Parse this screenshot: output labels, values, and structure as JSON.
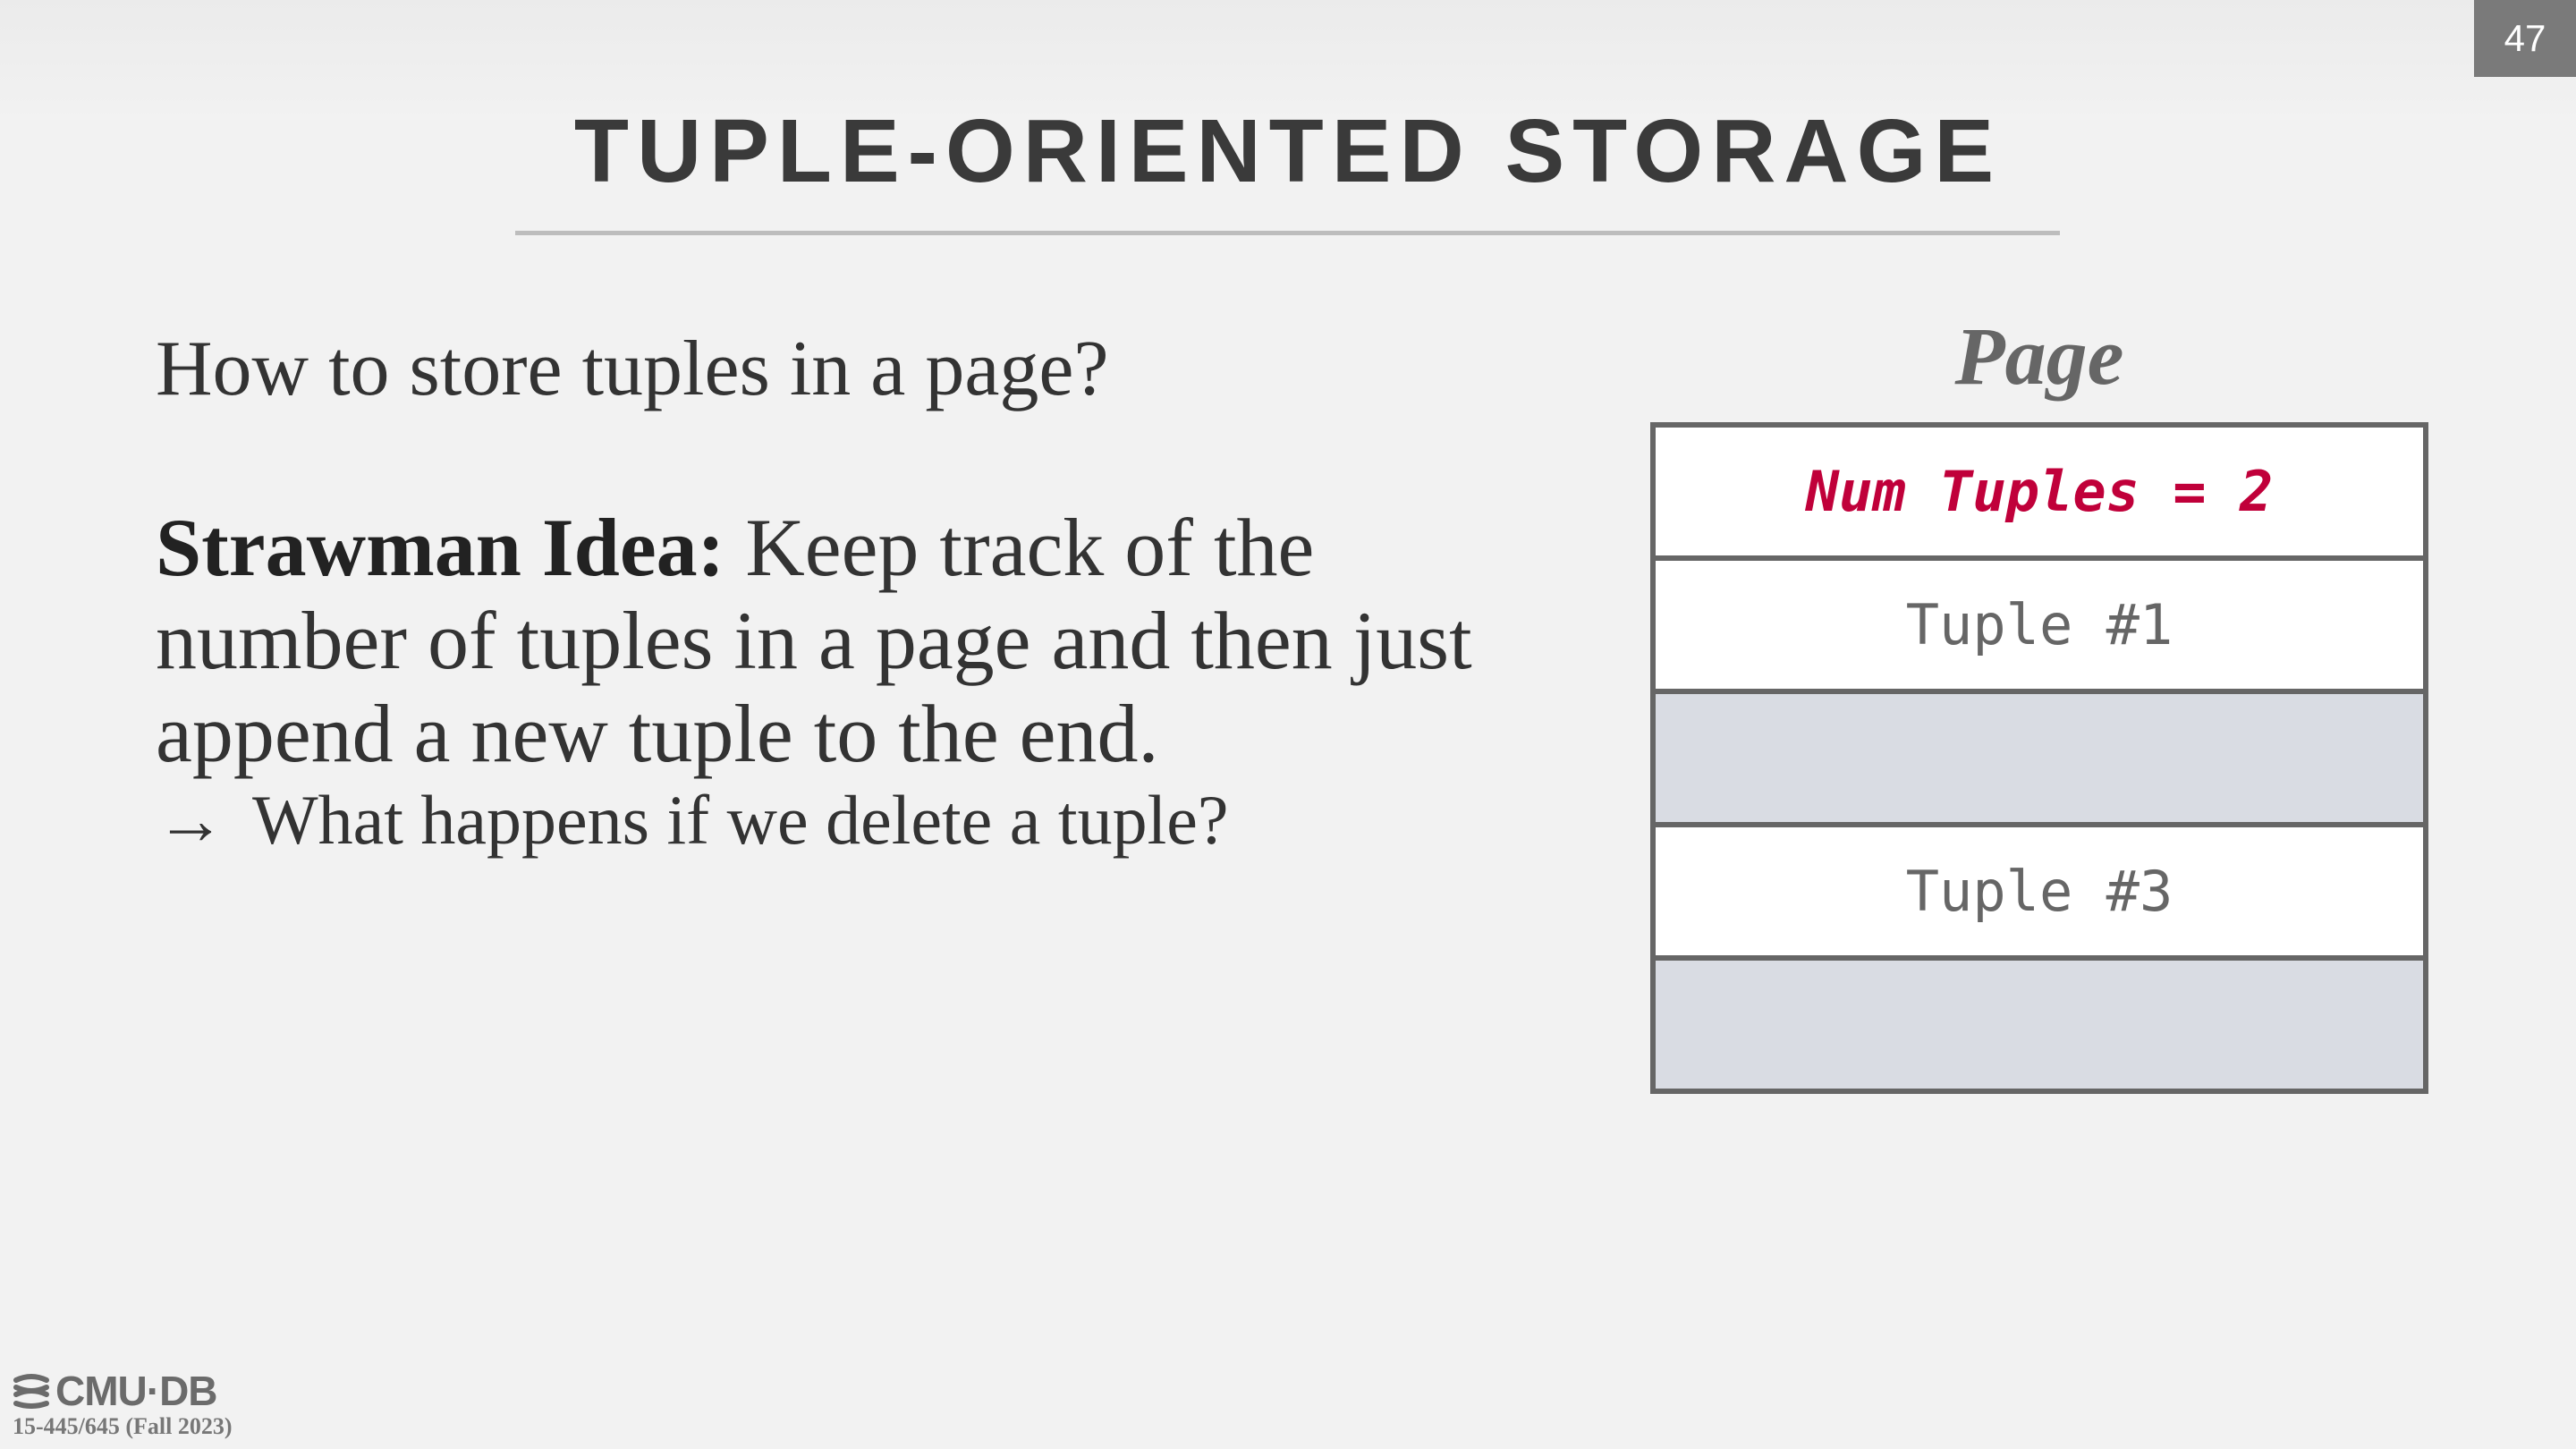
{
  "slide_number": "47",
  "title": "TUPLE-ORIENTED STORAGE",
  "question": "How to store tuples in a page?",
  "strawman": {
    "label": "Strawman Idea:",
    "text": " Keep track of the number of tuples in a page and then just append a new tuple to the end."
  },
  "followup": {
    "arrow": "→",
    "text": "What happens if we delete a tuple?"
  },
  "diagram": {
    "label": "Page",
    "header": "Num Tuples = 2",
    "rows": [
      "Tuple #1",
      "",
      "Tuple #3",
      ""
    ],
    "header_color": "#c0003a",
    "empty_color": "#d9dce3"
  },
  "footer": {
    "logo": "CMU·DB",
    "course": "15-445/645 (Fall 2023)"
  }
}
